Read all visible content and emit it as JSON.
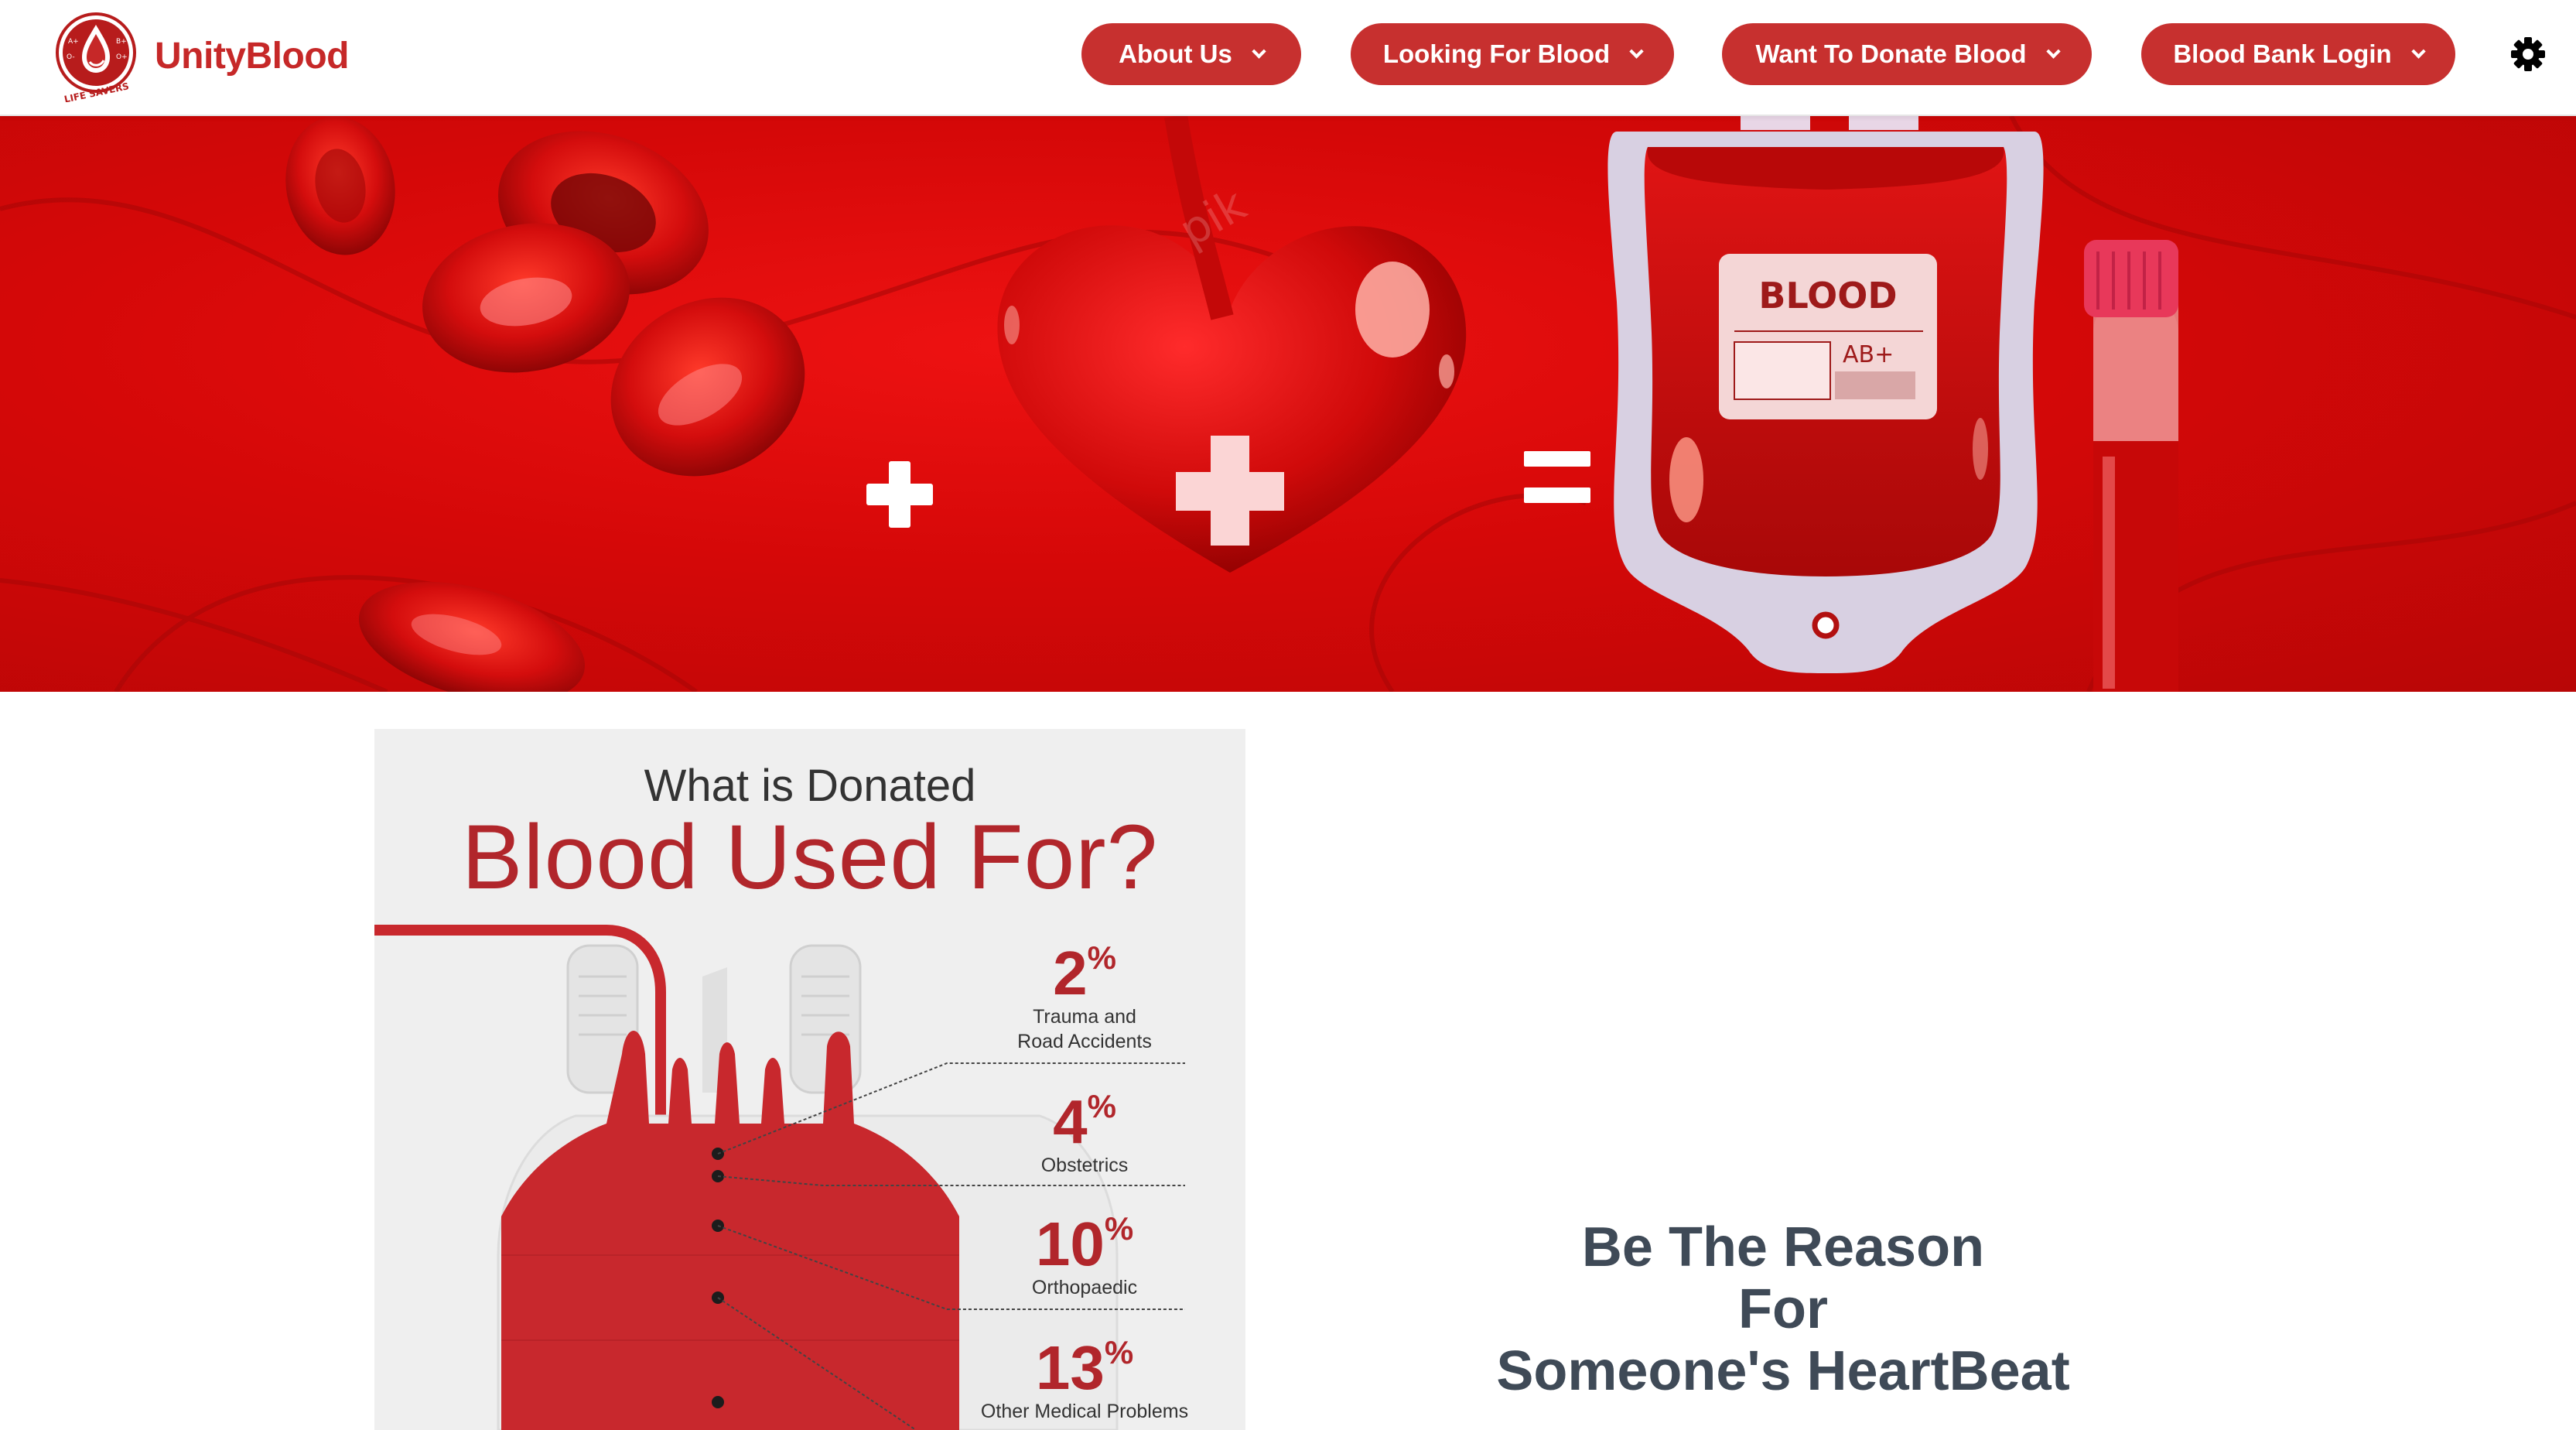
{
  "brand": {
    "name": "UnityBlood",
    "logo_text": "LIFE SAVERS",
    "logo_blood_types": [
      "A+",
      "B+",
      "O-",
      "O+"
    ]
  },
  "nav": {
    "items": [
      {
        "label": "About Us",
        "icon": "chevron-down-icon"
      },
      {
        "label": "Looking For Blood",
        "icon": "chevron-down-icon"
      },
      {
        "label": "Want To Donate Blood",
        "icon": "chevron-down-icon"
      },
      {
        "label": "Blood Bank Login",
        "icon": "chevron-down-icon"
      }
    ],
    "settings_icon": "gear-icon"
  },
  "hero": {
    "bag_label": "BLOOD",
    "bag_type": "AB+",
    "watermark": "pik"
  },
  "infographic": {
    "title_small": "What is Donated",
    "title_big": "Blood Used For?",
    "stats": [
      {
        "value": "2",
        "unit": "%",
        "desc_line1": "Trauma and",
        "desc_line2": "Road Accidents"
      },
      {
        "value": "4",
        "unit": "%",
        "desc_line1": "Obstetrics",
        "desc_line2": ""
      },
      {
        "value": "10",
        "unit": "%",
        "desc_line1": "Orthopaedic",
        "desc_line2": ""
      },
      {
        "value": "13",
        "unit": "%",
        "desc_line1": "Other Medical Problems",
        "desc_line2": ""
      }
    ]
  },
  "tagline": {
    "line1": "Be The Reason",
    "line2": "For",
    "line3": "Someone's HeartBeat"
  },
  "colors": {
    "brand_red": "#c62828",
    "button_red": "#c7302f",
    "hero_red": "#d50808",
    "infographic_red": "#b1262b",
    "tagline_text": "#3f4a57"
  }
}
